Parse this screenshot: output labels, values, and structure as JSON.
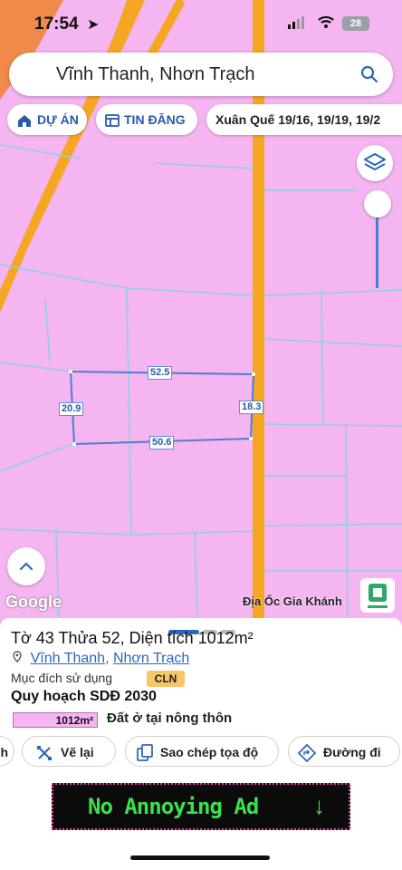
{
  "status": {
    "time": "17:54",
    "battery": "28"
  },
  "search": {
    "query": "Vĩnh Thanh, Nhơn Trạch"
  },
  "chips": {
    "project": "DỰ ÁN",
    "listing": "TIN ĐĂNG",
    "address": "Xuân Quế 19/16, 19/19, 19/2"
  },
  "map": {
    "edges": {
      "top": "52.5",
      "left": "20.9",
      "right": "18.3",
      "bottom": "50.6"
    },
    "attribution": "Google",
    "brand": "Địa Ốc Gia Khánh",
    "colors": {
      "land": "#f4b5f0",
      "road": "#f5a623",
      "parcel": "#4a7fd0"
    }
  },
  "parcel": {
    "title": "Tờ 43 Thửa 52, Diện tích 1012m²",
    "commune": "Vĩnh Thanh",
    "district": "Nhơn Trạch",
    "separator": ", ",
    "purpose_label": "Mục đích sử dụng",
    "purpose_code": "CLN",
    "plan_title": "Quy hoạch SDĐ 2030",
    "plan_area": "1012m²",
    "plan_type": "Đất ở tại nông thôn"
  },
  "actions": {
    "partial": "h",
    "redraw": "Vẽ lại",
    "copy": "Sao chép tọa độ",
    "route": "Đường đi"
  },
  "ad": {
    "text": "No Annoying Ad"
  }
}
